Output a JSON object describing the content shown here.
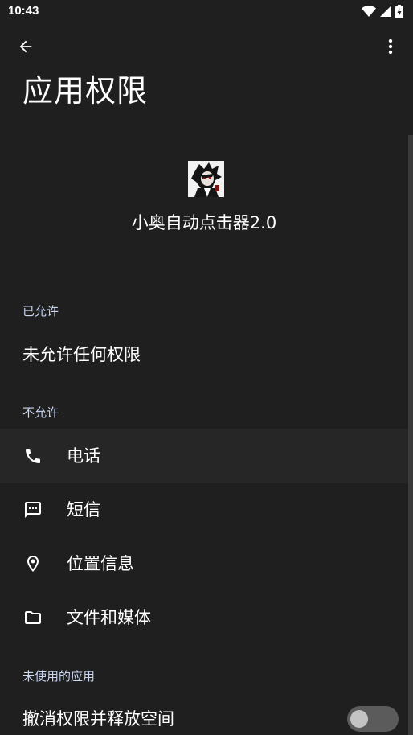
{
  "status_bar": {
    "time": "10:43"
  },
  "header": {
    "title": "应用权限"
  },
  "app": {
    "name": "小奥自动点击器2.0"
  },
  "allowed_section": {
    "label": "已允许",
    "empty_text": "未允许任何权限"
  },
  "denied_section": {
    "label": "不允许",
    "items": [
      {
        "label": "电话",
        "icon": "phone-icon"
      },
      {
        "label": "短信",
        "icon": "sms-icon"
      },
      {
        "label": "位置信息",
        "icon": "location-icon"
      },
      {
        "label": "文件和媒体",
        "icon": "folder-icon"
      }
    ]
  },
  "unused_section": {
    "label": "未使用的应用",
    "toggle_label": "撤消权限并释放空间",
    "toggle_on": false
  },
  "colors": {
    "background": "#1f1f1f",
    "section_label": "#c9d6f0",
    "highlight_row": "#262626"
  }
}
